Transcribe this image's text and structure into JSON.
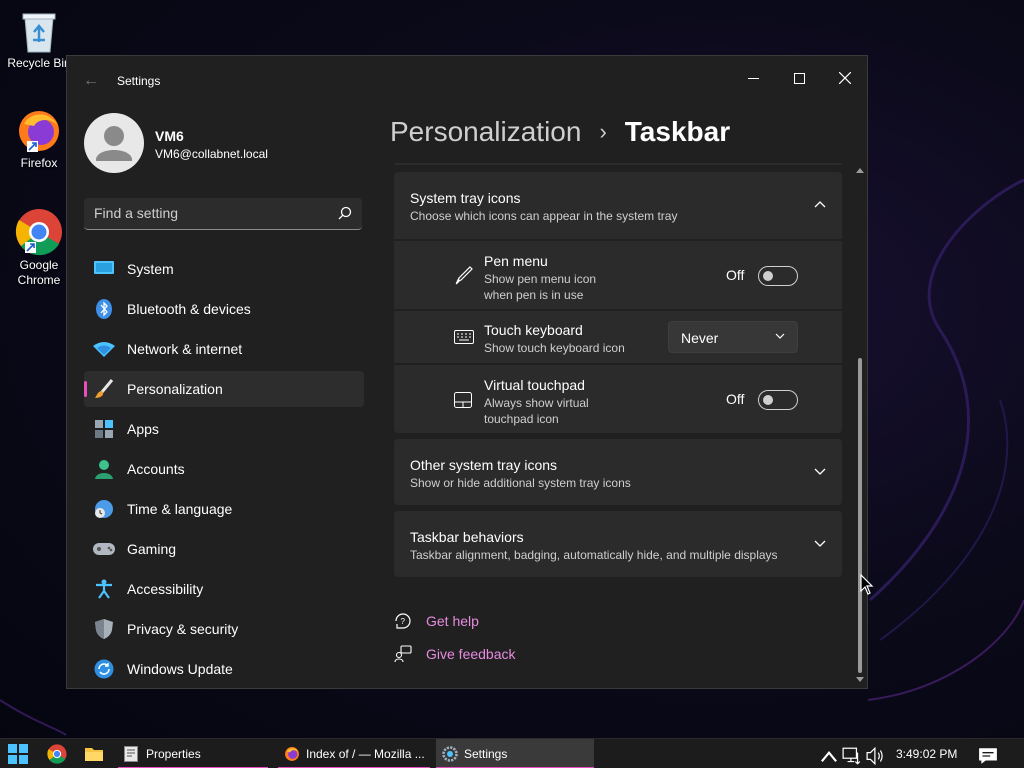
{
  "desktop": {
    "icons": [
      {
        "label": "Recycle Bin"
      },
      {
        "label": "Firefox"
      },
      {
        "label": "Google Chrome"
      }
    ]
  },
  "window": {
    "title": "Settings",
    "profile": {
      "name": "VM6",
      "email": "VM6@collabnet.local"
    },
    "search_placeholder": "Find a setting",
    "nav": [
      {
        "label": "System"
      },
      {
        "label": "Bluetooth & devices"
      },
      {
        "label": "Network & internet"
      },
      {
        "label": "Personalization"
      },
      {
        "label": "Apps"
      },
      {
        "label": "Accounts"
      },
      {
        "label": "Time & language"
      },
      {
        "label": "Gaming"
      },
      {
        "label": "Accessibility"
      },
      {
        "label": "Privacy & security"
      },
      {
        "label": "Windows Update"
      }
    ],
    "breadcrumb": {
      "parent": "Personalization",
      "current": "Taskbar"
    }
  },
  "content": {
    "system_tray": {
      "title": "System tray icons",
      "subtitle": "Choose which icons can appear in the system tray"
    },
    "pen_menu": {
      "title": "Pen menu",
      "subtitle1": "Show pen menu icon",
      "subtitle2": "when pen is in use",
      "state": "Off"
    },
    "touch_keyboard": {
      "title": "Touch keyboard",
      "subtitle": "Show touch keyboard icon",
      "value": "Never"
    },
    "virtual_touchpad": {
      "title": "Virtual touchpad",
      "subtitle1": "Always show virtual",
      "subtitle2": "touchpad icon",
      "state": "Off"
    },
    "other_tray": {
      "title": "Other system tray icons",
      "subtitle": "Show or hide additional system tray icons"
    },
    "behaviors": {
      "title": "Taskbar behaviors",
      "subtitle": "Taskbar alignment, badging, automatically hide, and multiple displays"
    },
    "get_help": "Get help",
    "give_feedback": "Give feedback"
  },
  "taskbar": {
    "tasks": [
      {
        "label": "Properties"
      },
      {
        "label": "Index of / — Mozilla ..."
      },
      {
        "label": "Settings"
      }
    ],
    "clock": "3:49:02 PM"
  },
  "colors": {
    "accent": "#e74fbf",
    "link": "#e68be0"
  }
}
